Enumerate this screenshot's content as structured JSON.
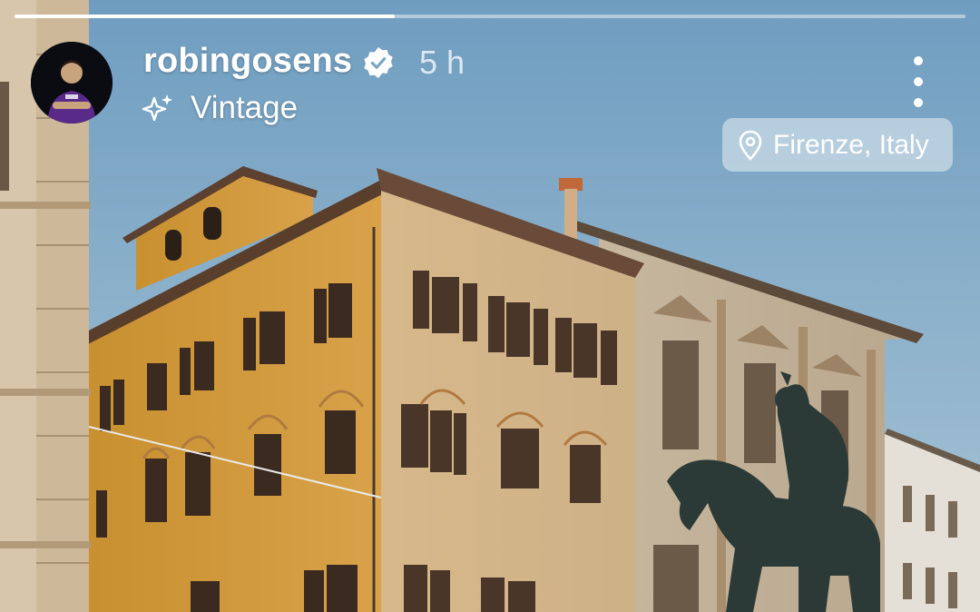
{
  "story": {
    "username": "robingosens",
    "verified": true,
    "time_ago": "5 h",
    "filter": {
      "icon": "sparkles-icon",
      "label": "Vintage"
    },
    "location": {
      "icon": "location-pin-icon",
      "label": "Firenze, Italy"
    },
    "progress": 0.4,
    "menu_icon": "more-vertical-icon"
  },
  "colors": {
    "sky": "#7fa7c4",
    "verified_badge": "#ffffff",
    "text": "#ffffff"
  }
}
